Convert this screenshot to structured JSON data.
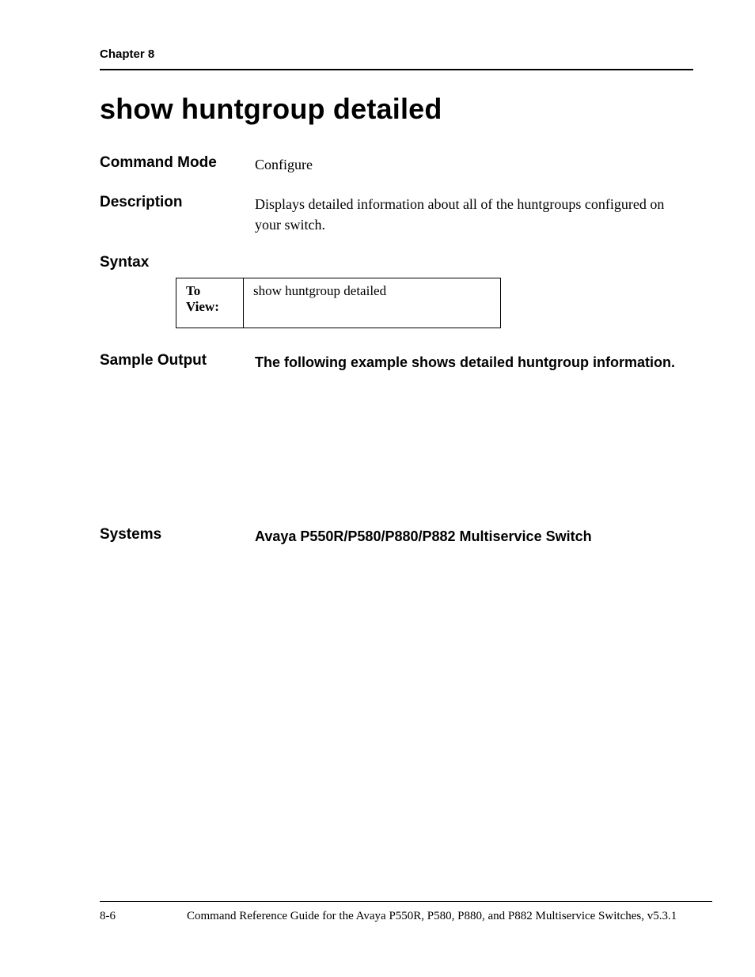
{
  "header": {
    "chapter": "Chapter 8"
  },
  "title": "show huntgroup detailed",
  "sections": {
    "command_mode": {
      "label": "Command Mode",
      "value": "Configure"
    },
    "description": {
      "label": "Description",
      "value": "Displays detailed information about all of the huntgroups configured on your switch."
    },
    "syntax": {
      "label": "Syntax",
      "table": {
        "row_label": "To View:",
        "command": "show huntgroup detailed"
      }
    },
    "sample_output": {
      "label": "Sample Output",
      "value": "The following example shows detailed huntgroup information."
    },
    "systems": {
      "label": "Systems",
      "value": "Avaya P550R/P580/P880/P882 Multiservice Switch"
    }
  },
  "footer": {
    "page": "8-6",
    "title": "Command Reference Guide for the Avaya P550R, P580, P880, and P882 Multiservice Switches, v5.3.1"
  }
}
